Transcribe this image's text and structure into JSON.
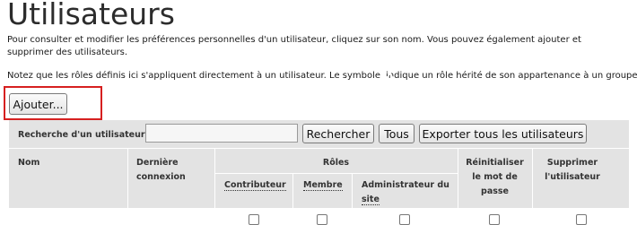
{
  "page": {
    "title": "Utilisateurs",
    "description": "Pour consulter et modifier les préférences personnelles d'un utilisateur, cliquez sur son nom. Vous pouvez également ajouter et supprimer des utilisateurs.",
    "note_before": "Notez que les rôles définis ici s'appliquent directement à un utilisateur. Le symbole",
    "note_after": "indique un rôle hérité de son appartenance à un groupe."
  },
  "toolbar": {
    "add_label": "Ajouter..."
  },
  "search": {
    "label": "Recherche d'un utilisateur:",
    "value": "",
    "search_button": "Rechercher",
    "all_button": "Tous",
    "export_button": "Exporter tous les utilisateurs"
  },
  "table": {
    "col_name": "Nom",
    "col_last_login_1": "Dernière",
    "col_last_login_2": "connexion",
    "roles_group": "Rôles",
    "role_contributor": "Contributeur",
    "role_member": "Membre",
    "role_admin_1": "Administrateur du",
    "role_admin_2": "site",
    "col_reset_1": "Réinitialiser",
    "col_reset_2": "le mot de",
    "col_reset_3": "passe",
    "col_delete_1": "Supprimer",
    "col_delete_2": "l'utilisateur"
  },
  "colors": {
    "highlight": "#d62020",
    "icon": "#2b7bd1",
    "panel": "#e3e3e3"
  },
  "icons": {
    "inherited_role": "group-inherited-icon"
  }
}
